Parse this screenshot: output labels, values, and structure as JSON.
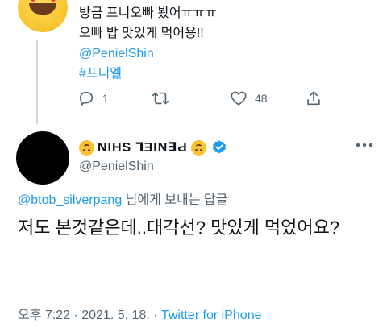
{
  "parent_tweet": {
    "lines": [
      "방금 프니오빠 봤어ㅠㅠㅠ",
      "오빠 밥 맛있게 먹어용!!"
    ],
    "mention": "@PenielShin",
    "hashtag": "#프니엘",
    "reply_count": "1",
    "like_count": "48"
  },
  "main_tweet": {
    "display_name": "NIHS ꓶƎIN∃Ԁ",
    "handle": "@PenielShin",
    "reply_to": {
      "account": "@btob_silverpang",
      "suffix": " 님에게 보내는 답글"
    },
    "text": "저도 본것같은데..대각선? 맛있게 먹었어요?",
    "time": "오후 7:22",
    "date": "2021. 5. 18.",
    "source": "Twitter for iPhone",
    "separator": " · "
  },
  "icons": {
    "reply": "reply-icon",
    "retweet": "retweet-icon",
    "like": "heart-icon",
    "share": "share-icon",
    "verified": "verified-badge-icon",
    "more": "more-options-icon"
  },
  "colors": {
    "link": "#1d9bf0",
    "muted": "#536471",
    "text": "#0f1419"
  }
}
